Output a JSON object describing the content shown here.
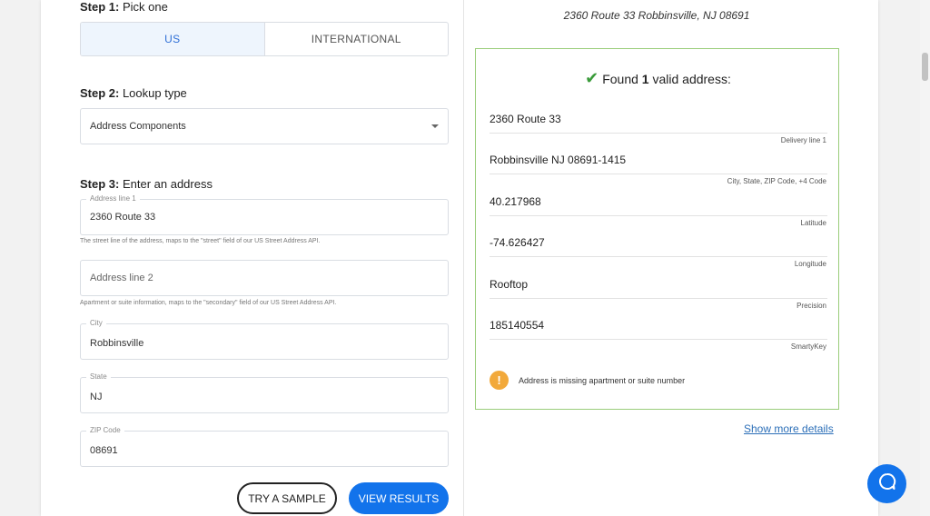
{
  "left": {
    "step1": {
      "prefix": "Step 1:",
      "text": " Pick one"
    },
    "tabs": [
      {
        "label": "US",
        "active": true
      },
      {
        "label": "INTERNATIONAL",
        "active": false
      }
    ],
    "step2": {
      "prefix": "Step 2:",
      "text": " Lookup type"
    },
    "lookup_type": "Address Components",
    "step3": {
      "prefix": "Step 3:",
      "text": " Enter an address"
    },
    "fields": {
      "address1": {
        "label": "Address line 1",
        "value": "2360 Route 33",
        "help": "The street line of the address, maps to the \"street\" field of our US Street Address API."
      },
      "address2": {
        "placeholder": "Address line 2",
        "help": "Apartment or suite information, maps to the \"secondary\" field of our US Street Address API."
      },
      "city": {
        "label": "City",
        "value": "Robbinsville"
      },
      "state": {
        "label": "State",
        "value": "NJ"
      },
      "zip": {
        "label": "ZIP Code",
        "value": "08691"
      }
    },
    "buttons": {
      "sample": "TRY A SAMPLE",
      "results": "VIEW RESULTS"
    }
  },
  "right": {
    "address_heading": "2360 Route 33 Robbinsville, NJ 08691",
    "found_prefix": "Found ",
    "found_count": "1",
    "found_suffix": " valid address:",
    "rows": [
      {
        "value": "2360 Route 33",
        "label": "Delivery line 1"
      },
      {
        "value": "Robbinsville NJ 08691-1415",
        "label": "City, State, ZIP Code, +4 Code"
      },
      {
        "value": "40.217968",
        "label": "Latitude"
      },
      {
        "value": "-74.626427",
        "label": "Longitude"
      },
      {
        "value": "Rooftop",
        "label": "Precision"
      },
      {
        "value": "185140554",
        "label": "SmartyKey"
      }
    ],
    "warning": "Address is missing apartment or suite number",
    "more_link": "Show more details"
  },
  "colors": {
    "primary": "#1273eb",
    "success": "#3a9b3a",
    "warning": "#f2a93b",
    "result_border": "#9acd7a"
  }
}
